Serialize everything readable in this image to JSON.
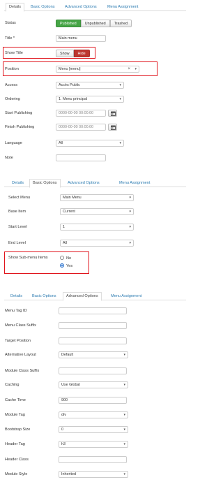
{
  "panel1": {
    "tabs": [
      "Details",
      "Basic Options",
      "Advanced Options",
      "Menu Assignment"
    ],
    "status_label": "Status",
    "status_options": [
      "Published",
      "Unpublished",
      "Trashed"
    ],
    "title_label": "Title *",
    "title_value": "Main menu",
    "show_title_label": "Show Title",
    "show_title_options": [
      "Show",
      "Hide"
    ],
    "position_label": "Position",
    "position_value": "Menu [menu]",
    "position_clear": "×",
    "access_label": "Access",
    "access_value": "Accès Public",
    "ordering_label": "Ordering",
    "ordering_value": "1. Menu principal",
    "start_publishing_label": "Start Publishing",
    "start_publishing_value": "0000-00-00 00:00:00",
    "finish_publishing_label": "Finish Publishing",
    "finish_publishing_value": "0000-00-00 00:00:00",
    "language_label": "Language",
    "language_value": "All",
    "note_label": "Note",
    "note_value": ""
  },
  "panel2": {
    "tabs": [
      "Details",
      "Basic Options",
      "Advanced Options",
      "Menu Assignment"
    ],
    "select_menu_label": "Select Menu",
    "select_menu_value": "Main Menu",
    "base_item_label": "Base Item",
    "base_item_value": "Current",
    "start_level_label": "Start Level",
    "start_level_value": "1",
    "end_level_label": "End Level",
    "end_level_value": "All",
    "show_submenu_label": "Show Sub-menu Items",
    "show_submenu_no": "No",
    "show_submenu_yes": "Yes"
  },
  "panel3": {
    "tabs": [
      "Details",
      "Basic Options",
      "Advanced Options",
      "Menu Assignment"
    ],
    "menu_tag_id_label": "Menu Tag ID",
    "menu_class_suffix_label": "Menu Class Suffix",
    "target_position_label": "Target Position",
    "alternative_layout_label": "Alternative Layout",
    "alternative_layout_value": "Default",
    "module_class_suffix_label": "Module Class Suffix",
    "caching_label": "Caching",
    "caching_value": "Use Global",
    "cache_time_label": "Cache Time",
    "cache_time_value": "900",
    "module_tag_label": "Module Tag",
    "module_tag_value": "div",
    "bootstrap_size_label": "Bootstrap Size",
    "bootstrap_size_value": "0",
    "header_tag_label": "Header Tag",
    "header_tag_value": "h3",
    "header_class_label": "Header Class",
    "module_style_label": "Module Style",
    "module_style_value": "Inherited"
  },
  "icons": {
    "dropdown": "⌃",
    "calendar": "calendar-icon"
  },
  "colors": {
    "published": "#46a546",
    "hide": "#bd362f",
    "highlight": "#e0141c",
    "link": "#2a7ab0"
  }
}
